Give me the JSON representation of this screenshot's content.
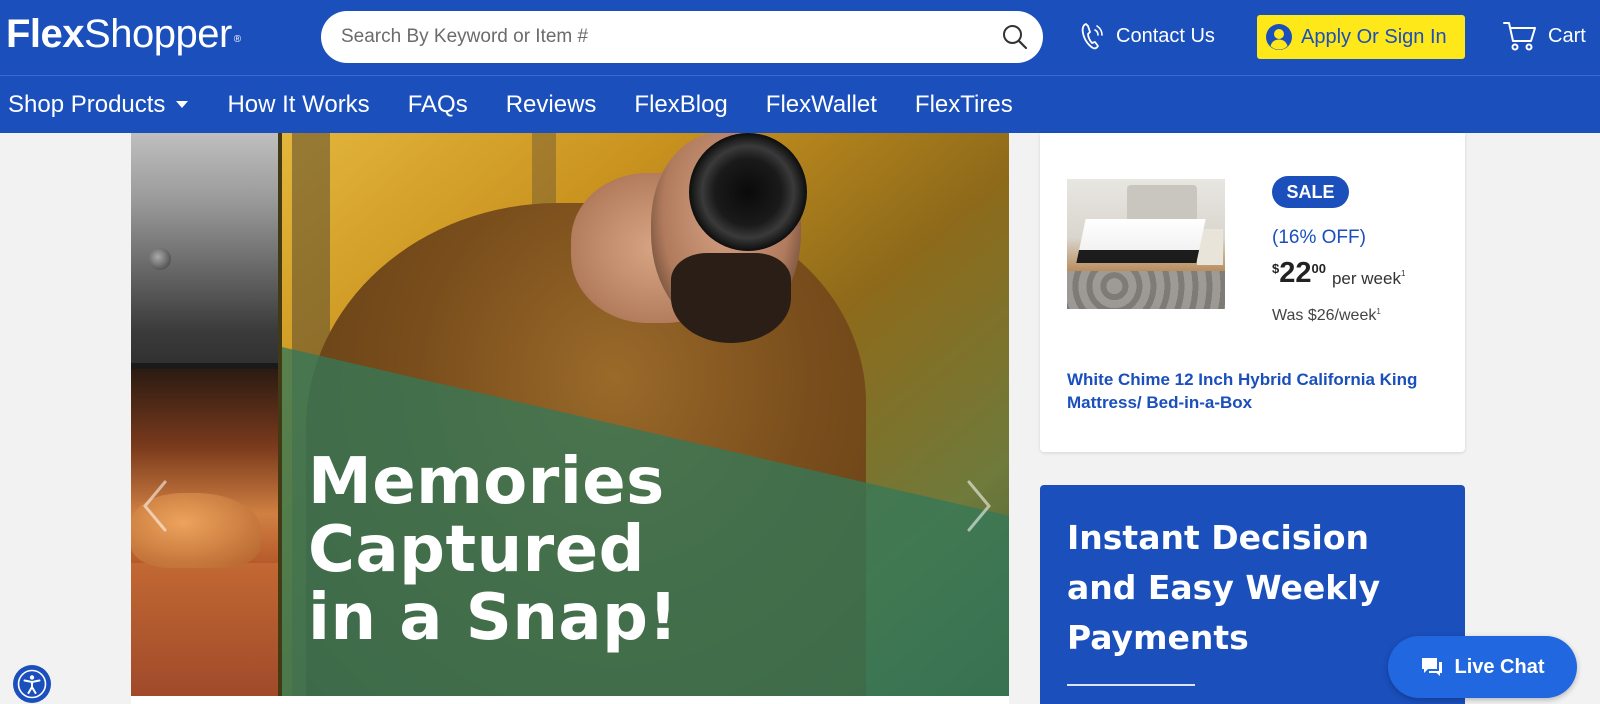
{
  "header": {
    "logo_bold": "Flex",
    "logo_regular": "Shopper",
    "logo_mark": "®",
    "search_placeholder": "Search By Keyword or Item #",
    "contact_label": "Contact Us",
    "apply_label": "Apply Or Sign In",
    "cart_label": "Cart"
  },
  "nav": {
    "items": [
      {
        "label": "Shop Products",
        "has_dropdown": true
      },
      {
        "label": "How It Works"
      },
      {
        "label": "FAQs"
      },
      {
        "label": "Reviews"
      },
      {
        "label": "FlexBlog"
      },
      {
        "label": "FlexWallet"
      },
      {
        "label": "FlexTires"
      }
    ]
  },
  "hero": {
    "headline_line1": "Memories",
    "headline_line2": "Captured",
    "headline_line3": "in a Snap!"
  },
  "product": {
    "badge": "SALE",
    "discount": "(16% OFF)",
    "price_currency": "$",
    "price_dollars": "22",
    "price_cents": "00",
    "price_unit": "per week",
    "footnote": "1",
    "was_price": "Was $26/week",
    "title": "White Chime 12 Inch Hybrid California King Mattress/ Bed-in-a-Box"
  },
  "promo": {
    "line1": "Instant Decision",
    "line2": "and Easy Weekly",
    "line3": "Payments"
  },
  "chat": {
    "label": "Live Chat"
  },
  "colors": {
    "brand_blue": "#1a4fbc",
    "accent_yellow": "#ffe81a",
    "chat_blue": "#2168e0"
  },
  "icons": {
    "search": "search-icon",
    "phone": "phone-icon",
    "user": "user-icon",
    "cart": "cart-icon",
    "caret": "chevron-down-icon",
    "chat": "chat-bubble-icon",
    "accessibility": "accessibility-icon",
    "prev": "chevron-left-icon",
    "next": "chevron-right-icon"
  }
}
